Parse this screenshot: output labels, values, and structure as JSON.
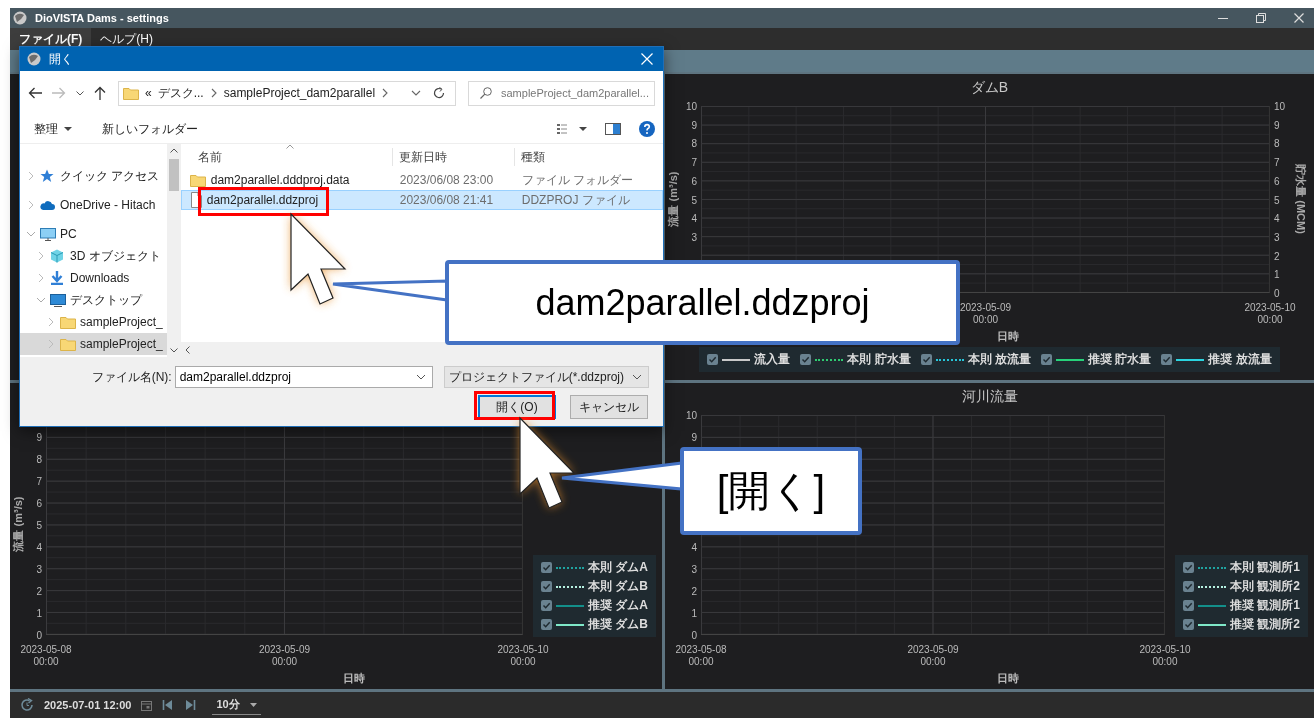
{
  "window": {
    "title": "DioVISTA Dams - settings"
  },
  "menu": [
    {
      "label": "ファイル(F)",
      "selected": true
    },
    {
      "label": "ヘルプ(H)",
      "selected": false
    }
  ],
  "charts": [
    {
      "title": "ダムB",
      "y_label": "流量 (m³/s)",
      "y_ticks": [
        "10",
        "9",
        "8",
        "7",
        "6",
        "5",
        "4",
        "3"
      ],
      "y2_label": "貯水量 (MCM)",
      "y2_ticks": [
        "10",
        "9",
        "8",
        "7",
        "6",
        "5",
        "4",
        "3",
        "2",
        "1",
        "0"
      ],
      "x_ticks": [
        {
          "date": "2023-05-09",
          "time": "00:00"
        },
        {
          "date": "2023-05-10",
          "time": "00:00"
        }
      ],
      "x_label": "日時",
      "legend": [
        {
          "label": "流入量",
          "checked": true,
          "kind": "solid",
          "color": "#c8c8c8"
        },
        {
          "label": "本則 貯水量",
          "checked": true,
          "kind": "dotted",
          "color": "#2ecc71"
        },
        {
          "label": "本則 放流量",
          "checked": true,
          "kind": "dotted",
          "color": "#26c6da"
        },
        {
          "label": "推奨 貯水量",
          "checked": true,
          "kind": "solid",
          "color": "#27d27a"
        },
        {
          "label": "推奨 放流量",
          "checked": true,
          "kind": "solid",
          "color": "#2bd4e0"
        }
      ]
    },
    {
      "y_label": "流量 (m³/s)",
      "y_ticks": [
        "9",
        "8",
        "7",
        "6",
        "5",
        "4",
        "3",
        "2",
        "1",
        "0"
      ],
      "x_ticks": [
        {
          "date": "2023-05-08",
          "time": "00:00"
        },
        {
          "date": "2023-05-09",
          "time": "00:00"
        },
        {
          "date": "2023-05-10",
          "time": "00:00"
        }
      ],
      "x_label": "日時",
      "legend": [
        {
          "label": "本則 ダムA",
          "checked": true,
          "kind": "dotted",
          "color": "#1fa3a0"
        },
        {
          "label": "本則 ダムB",
          "checked": true,
          "kind": "dotted",
          "color": "#b6f2e2"
        },
        {
          "label": "推奨 ダムA",
          "checked": true,
          "kind": "solid",
          "color": "#138f8a"
        },
        {
          "label": "推奨 ダムB",
          "checked": true,
          "kind": "solid",
          "color": "#7fe8c8"
        }
      ]
    },
    {
      "title": "河川流量",
      "y_ticks": [
        "10",
        "9",
        "4",
        "3",
        "2",
        "1",
        "0"
      ],
      "x_ticks": [
        {
          "date": "2023-05-08",
          "time": "00:00"
        },
        {
          "date": "2023-05-09",
          "time": "00:00"
        },
        {
          "date": "2023-05-10",
          "time": "00:00"
        }
      ],
      "x_label": "日時",
      "legend": [
        {
          "label": "本則 観測所1",
          "checked": true,
          "kind": "dotted",
          "color": "#1fa3a0"
        },
        {
          "label": "本則 観測所2",
          "checked": true,
          "kind": "dotted",
          "color": "#b6f2e2"
        },
        {
          "label": "推奨 観測所1",
          "checked": true,
          "kind": "solid",
          "color": "#138f8a"
        },
        {
          "label": "推奨 観測所2",
          "checked": true,
          "kind": "solid",
          "color": "#7fe8c8"
        }
      ]
    }
  ],
  "dialog": {
    "title": "開く",
    "address": {
      "overflow": "«",
      "segments": [
        "デスク...",
        "sampleProject_dam2parallel"
      ]
    },
    "search": {
      "placeholder": "sampleProject_dam2parallel..."
    },
    "commands": [
      {
        "label": "整理",
        "kind": "menu"
      },
      {
        "label": "新しいフォルダー",
        "kind": "plain"
      }
    ],
    "nav": [
      {
        "label": "クイック アクセス",
        "kind": "favorites",
        "expanded": false,
        "selected": false
      },
      {
        "label": "OneDrive - Hitach",
        "kind": "cloud",
        "expanded": false,
        "selected": false
      },
      {
        "label": "PC",
        "kind": "computer",
        "expanded": true,
        "selected": false,
        "children": [
          {
            "label": "3D オブジェクト",
            "kind": "objects",
            "expanded": false,
            "selected": false
          },
          {
            "label": "Downloads",
            "kind": "downloads",
            "expanded": false,
            "selected": false
          },
          {
            "label": "デスクトップ",
            "kind": "desktop",
            "expanded": true,
            "selected": false,
            "children": [
              {
                "label": "sampleProject_",
                "kind": "folder",
                "expanded": false,
                "selected": false
              },
              {
                "label": "sampleProject_",
                "kind": "folder",
                "expanded": false,
                "selected": true
              }
            ]
          }
        ]
      }
    ],
    "columns": [
      "名前",
      "更新日時",
      "種類"
    ],
    "files": [
      {
        "name": "dam2parallel.dddproj.data",
        "modified": "2023/06/08 23:00",
        "type": "ファイル フォルダー",
        "kind": "folder",
        "selected": false
      },
      {
        "name": "dam2parallel.ddzproj",
        "modified": "2023/06/08 21:41",
        "type": "DDZPROJ ファイル",
        "kind": "file",
        "selected": true
      }
    ],
    "file_name_label": "ファイル名(N):",
    "file_name": "dam2parallel.ddzproj",
    "filter": "プロジェクトファイル(*.ddzproj)",
    "buttons": [
      {
        "label": "開く(O)",
        "default": true
      },
      {
        "label": "キャンセル",
        "default": false
      }
    ]
  },
  "status_bar": {
    "datetime": "2025-07-01 12:00",
    "step": "10分"
  },
  "callouts": [
    {
      "text": "dam2parallel.ddzproj"
    },
    {
      "text": "[開く]"
    }
  ]
}
